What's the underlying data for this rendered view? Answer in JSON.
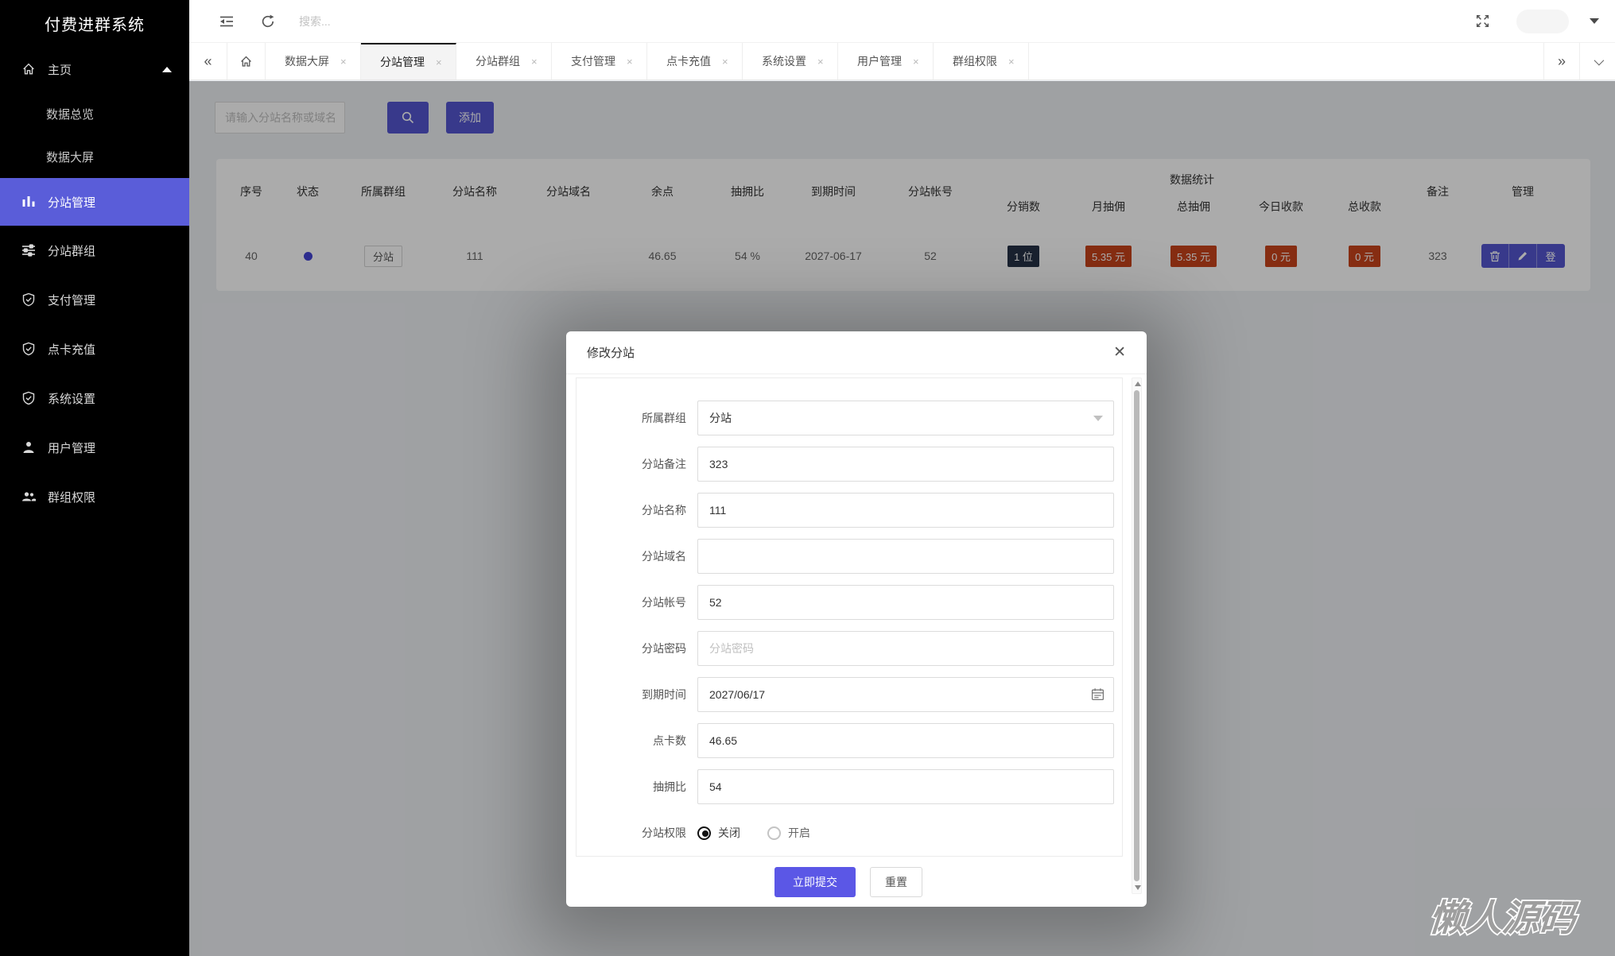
{
  "app": {
    "title": "付费进群系统"
  },
  "sidebar": {
    "items": [
      {
        "label": "主页"
      },
      {
        "label": "数据总览"
      },
      {
        "label": "数据大屏"
      },
      {
        "label": "分站管理",
        "active": true
      },
      {
        "label": "分站群组"
      },
      {
        "label": "支付管理"
      },
      {
        "label": "点卡充值"
      },
      {
        "label": "系统设置"
      },
      {
        "label": "用户管理"
      },
      {
        "label": "群组权限"
      }
    ]
  },
  "toolbar": {
    "search_placeholder": "搜索..."
  },
  "tabbar": {
    "collapse": "«",
    "expand": "»",
    "close": "×",
    "tabs": [
      {
        "label": "数据大屏"
      },
      {
        "label": "分站管理",
        "active": true
      },
      {
        "label": "分站群组"
      },
      {
        "label": "支付管理"
      },
      {
        "label": "点卡充值"
      },
      {
        "label": "系统设置"
      },
      {
        "label": "用户管理"
      },
      {
        "label": "群组权限"
      }
    ]
  },
  "content": {
    "search_placeholder": "请输入分站名称或域名",
    "add_label": "添加",
    "table": {
      "columns": [
        "序号",
        "状态",
        "所属群组",
        "分站名称",
        "分站域名",
        "余点",
        "抽拥比",
        "到期时间",
        "分站帐号"
      ],
      "stats_group": {
        "label": "数据统计",
        "children": [
          "分销数",
          "月抽佣",
          "总抽佣",
          "今日收款",
          "总收款"
        ]
      },
      "tail_columns": [
        "备注",
        "管理"
      ],
      "row": {
        "seq": "40",
        "group": "分站",
        "name": "111",
        "domain": "",
        "balance": "46.65",
        "rate": "54 %",
        "expire": "2027-06-17",
        "account": "52",
        "distributors": "1 位",
        "month_commission": "5.35 元",
        "total_commission": "5.35 元",
        "today_income": "0 元",
        "total_income": "0 元",
        "remark": "323",
        "login": "登"
      }
    }
  },
  "modal": {
    "title": "修改分站",
    "close": "✕",
    "fields": {
      "group": {
        "label": "所属群组",
        "value": "分站"
      },
      "remark": {
        "label": "分站备注",
        "value": "323"
      },
      "name": {
        "label": "分站名称",
        "value": "111"
      },
      "domain": {
        "label": "分站域名",
        "value": ""
      },
      "account": {
        "label": "分站帐号",
        "value": "52"
      },
      "password": {
        "label": "分站密码",
        "placeholder": "分站密码"
      },
      "expire": {
        "label": "到期时间",
        "value": "2027/06/17"
      },
      "points": {
        "label": "点卡数",
        "value": "46.65"
      },
      "rate": {
        "label": "抽拥比",
        "value": "54"
      },
      "permission": {
        "label": "分站权限",
        "off": "关闭",
        "on": "开启",
        "selected": "关闭"
      }
    },
    "submit_label": "立即提交",
    "reset_label": "重置"
  },
  "watermark": "懒人源码",
  "colors": {
    "accent": "#5456cf",
    "sidebar_active": "#5a5dd9",
    "submit_button": "#5b57e6",
    "badge_red": "#c8441c",
    "badge_dark": "#263246",
    "status_dot": "#4444d4",
    "active_tab_bar": "#1c1c1c"
  }
}
